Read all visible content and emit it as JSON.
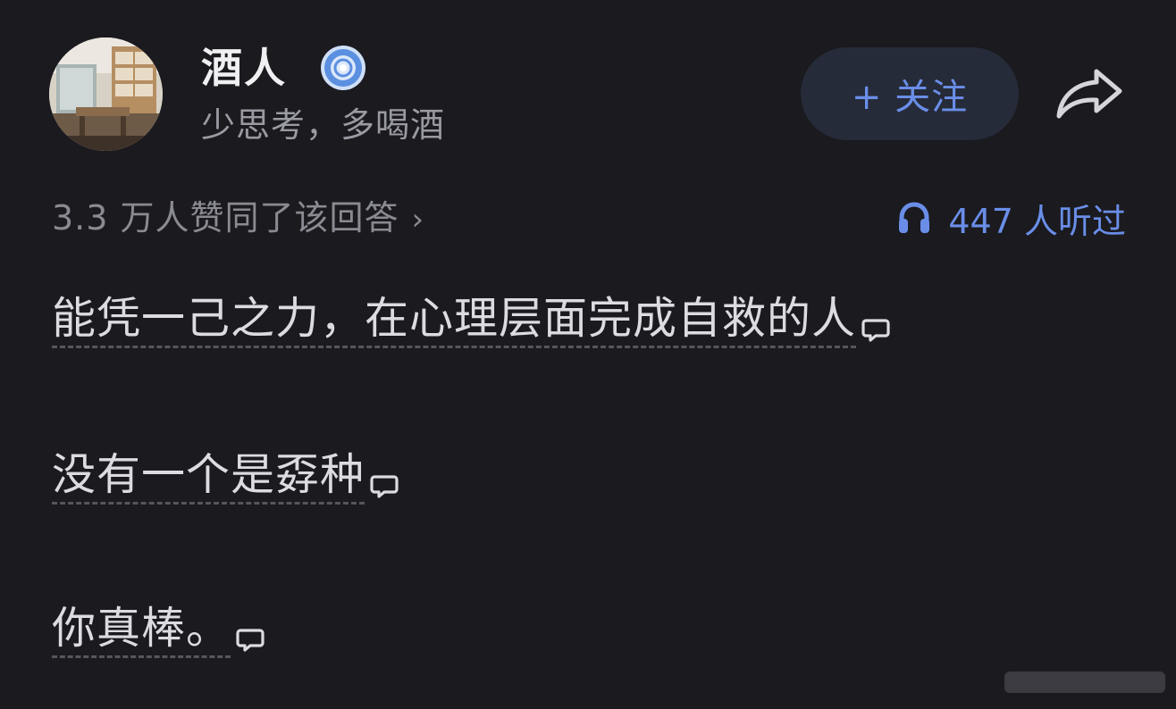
{
  "author": {
    "name": "酒人",
    "bio": "少思考，多喝酒",
    "verified_badge_icon": "verified-badge-icon",
    "avatar_icon": "avatar"
  },
  "actions": {
    "follow_label": "+ 关注",
    "share_icon": "share-icon"
  },
  "stats": {
    "approve_text": "3.3 万人赞同了该回答",
    "approve_chevron": "›",
    "listen_text": "447 人听过",
    "listen_icon": "headphone-icon"
  },
  "content": {
    "paragraphs": [
      "能凭一己之力，在心理层面完成自救的人",
      "没有一个是孬种",
      "你真棒。"
    ]
  },
  "colors": {
    "background": "#1a1a1f",
    "accent": "#6a8ee8",
    "text_primary": "#dcdce0",
    "text_secondary": "#8a8a92",
    "button_bg": "#262b39"
  }
}
